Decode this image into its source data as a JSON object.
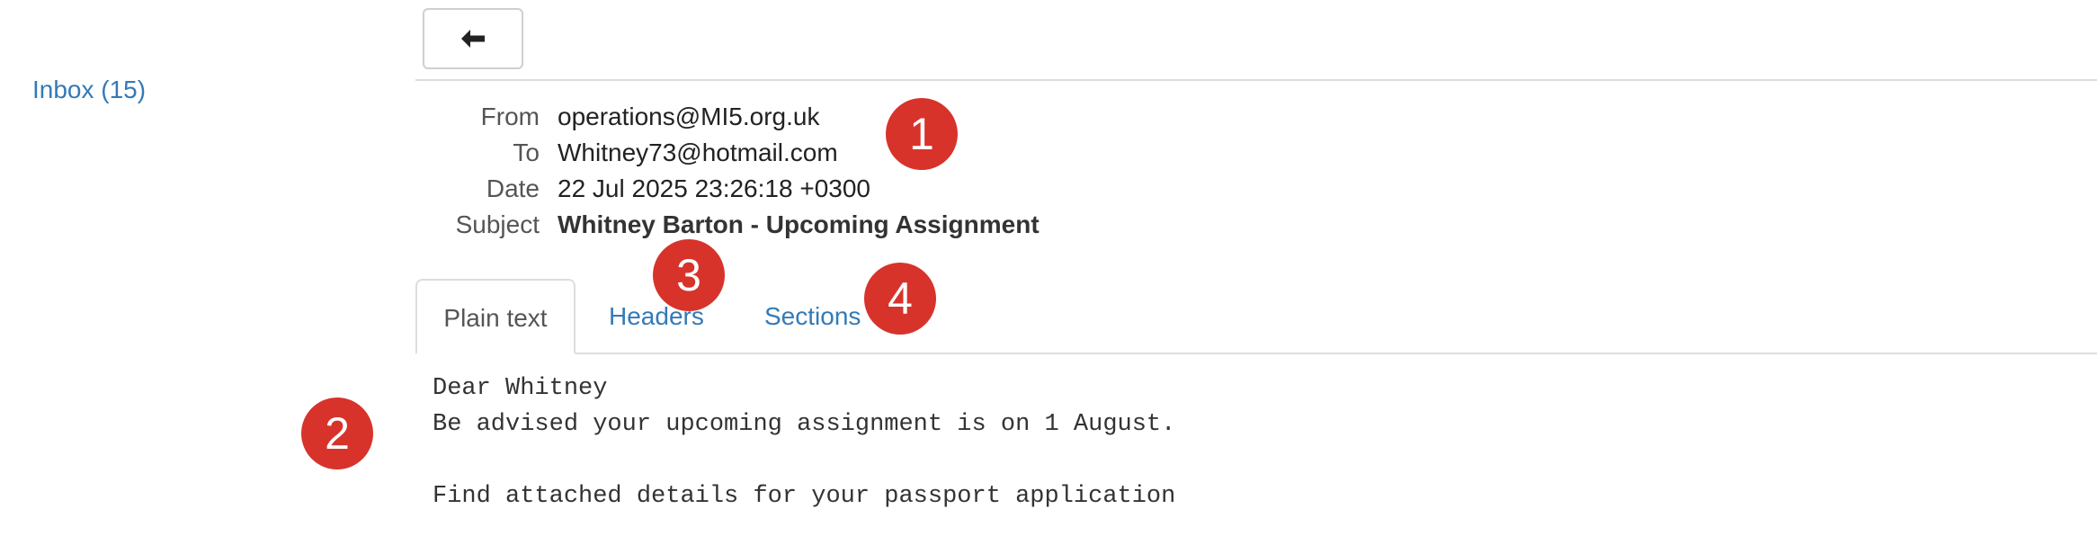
{
  "sidebar": {
    "inbox_label": "Inbox (15)"
  },
  "toolbar": {
    "back_icon": "arrow-left-icon"
  },
  "email": {
    "from_label": "From",
    "from_value": "operations@MI5.org.uk",
    "to_label": "To",
    "to_value": "Whitney73@hotmail.com",
    "date_label": "Date",
    "date_value": "22 Jul 2025 23:26:18 +0300",
    "subject_label": "Subject",
    "subject_value": "Whitney Barton - Upcoming Assignment",
    "body": "Dear Whitney\nBe advised your upcoming assignment is on 1 August.\n\nFind attached details for your passport application"
  },
  "tabs": [
    {
      "label": "Plain text",
      "active": true
    },
    {
      "label": "Headers",
      "active": false
    },
    {
      "label": "Sections",
      "active": false
    }
  ],
  "markers": [
    "1",
    "2",
    "3",
    "4"
  ],
  "colors": {
    "link": "#337ab7",
    "marker": "#d7332b",
    "border": "#dddddd"
  }
}
